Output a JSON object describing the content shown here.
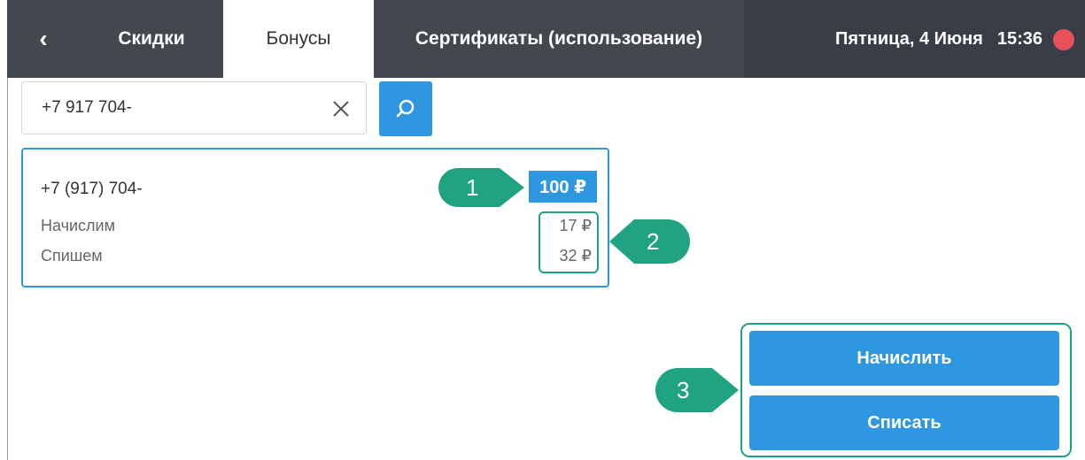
{
  "header": {
    "back_icon": "chevron-left-icon",
    "back_label": "‹",
    "tabs": [
      {
        "label": "Скидки",
        "active": false
      },
      {
        "label": "Бонусы",
        "active": true
      },
      {
        "label": "Сертификаты (использование)",
        "active": false
      }
    ],
    "date": "Пятница, 4 Июня",
    "time": "15:36",
    "status_color": "#e8505b"
  },
  "search": {
    "value": "+7 917 704-",
    "clear_icon": "close-icon",
    "button_icon": "search-icon"
  },
  "client": {
    "phone": "+7 (917) 704-",
    "balance": "100 ₽",
    "rows": [
      {
        "label": "Начислим",
        "amount": "17 ₽"
      },
      {
        "label": "Спишем",
        "amount": "32 ₽"
      }
    ]
  },
  "callouts": [
    "1",
    "2",
    "3"
  ],
  "actions": {
    "accrue_label": "Начислить",
    "writeoff_label": "Списать"
  },
  "colors": {
    "accent": "#2f96e0",
    "header": "#393e46",
    "callout": "#1fa383"
  }
}
